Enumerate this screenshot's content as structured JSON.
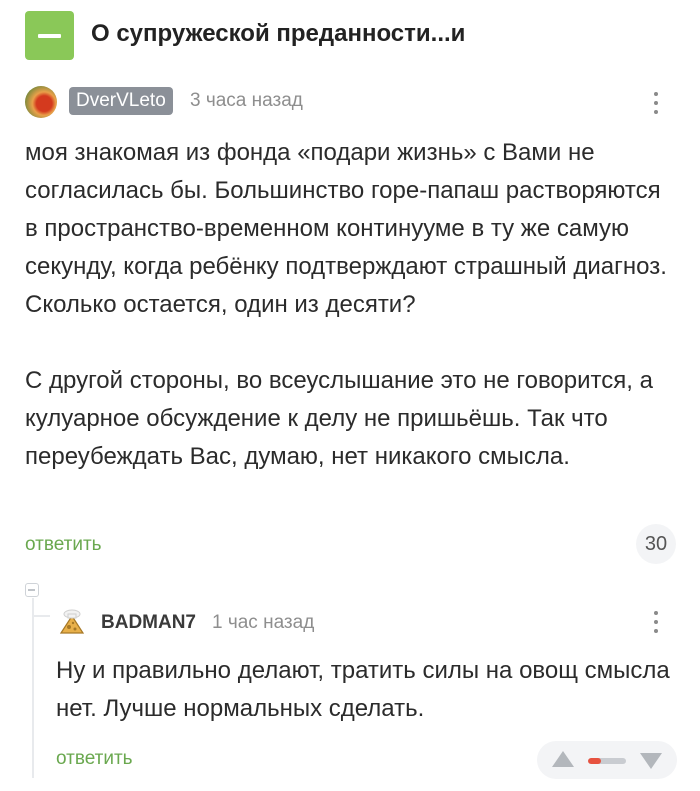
{
  "header": {
    "title": "О супружеской преданности...и",
    "collapse_icon": "minus-icon",
    "accent_color": "#8ac858"
  },
  "comment": {
    "author": "DverVLeto",
    "time": "3 часа назад",
    "paragraphs": [
      "моя знакомая из фонда «подари жизнь» с Вами не согласилась бы. Большинство горе-папаш растворяются в пространство-временном континууме в ту же самую секунду, когда ребёнку подтверждают страшный диагноз. Сколько остается, один из десяти?",
      "С другой стороны, во всеуслышание это не говорится, а кулуарное обсуждение к делу не пришьёшь. Так что переубеждать Вас, думаю, нет никакого смысла."
    ],
    "reply_label": "ответить",
    "rating": "30",
    "menu_icon": "more-vertical-icon"
  },
  "reply": {
    "author": "BADMAN7",
    "time": "1 час назад",
    "text": "Ну и правильно делают, тратить силы на овощ смысла нет. Лучше нормальных сделать.",
    "reply_label": "ответить",
    "menu_icon": "more-vertical-icon",
    "vote_ratio": 0.35,
    "vote_color": "#e7523f"
  },
  "link_color": "#6aa84f"
}
